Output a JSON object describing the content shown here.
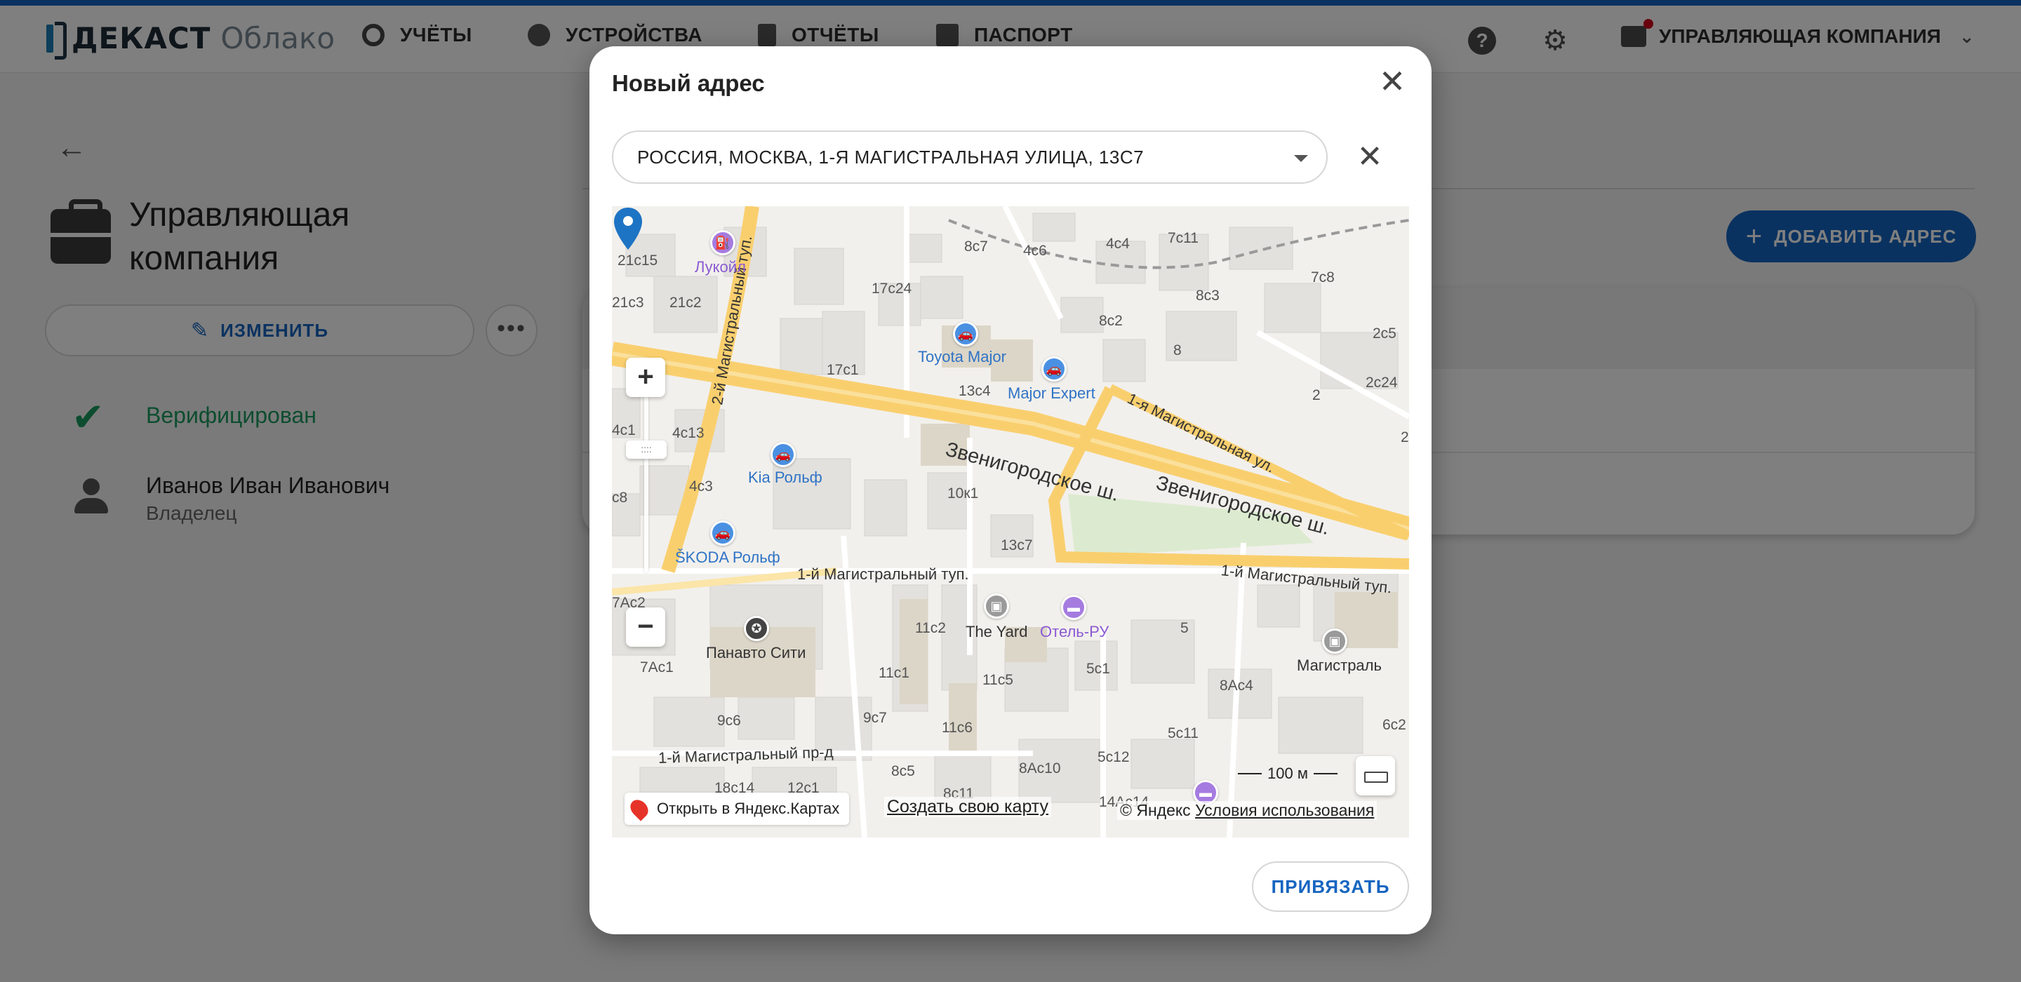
{
  "app": {
    "logo_text": "ДЕКАСТ",
    "logo_sub": "Облако"
  },
  "nav": {
    "items": [
      {
        "label": "УЧЁТЫ",
        "icon": "meter-icon"
      },
      {
        "label": "УСТРОЙСТВА",
        "icon": "device-icon"
      },
      {
        "label": "ОТЧЁТЫ",
        "icon": "report-icon"
      },
      {
        "label": "ПАСПОРТ",
        "icon": "passport-icon"
      }
    ],
    "help_icon": "?",
    "company_menu_label": "УПРАВЛЯЮЩАЯ КОМПАНИЯ"
  },
  "company": {
    "title": "Управляющая компания",
    "edit_label": "ИЗМЕНИТЬ",
    "more_label": "•••",
    "status": "Верифицирован",
    "owner_name": "Иванов Иван Иванович",
    "owner_role": "Владелец",
    "add_address_label": "ДОБАВИТЬ АДРЕС"
  },
  "dialog": {
    "title": "Новый адрес",
    "address_value": "РОССИЯ, МОСКВА, 1-Я МАГИСТРАЛЬНАЯ УЛИЦА, 13С7",
    "bind_label": "ПРИВЯЗАТЬ"
  },
  "map": {
    "open_in_yandex": "Открыть в Яндекс.Картах",
    "create_map": "Создать свою карту",
    "copyright": "© Яндекс",
    "terms": "Условия использования",
    "scale": "100 м",
    "streets": {
      "zvenigorodskoe_1": "Звенигородское ш.",
      "zvenigorodskoe_2": "Звенигородское ш.",
      "magistralny_tup_2": "2-й Магистральный туп.",
      "magistralnaya_ul_1": "1-я Магистральная ул.",
      "magistralny_tup_1_left": "1-й Магистральный туп.",
      "magistralny_tup_1_right": "1-й Магистральный туп.",
      "magistralny_pr": "1-й Магистральный пр-д"
    },
    "pois": {
      "lukoil": "Лукойл",
      "toyota": "Toyota Major",
      "major_expert": "Major Expert",
      "kia": "Kia Рольф",
      "skoda": "ŠKODA Рольф",
      "yard": "The Yard",
      "hotel": "Отель-РУ",
      "panavto": "Панавто Сити",
      "magistral": "Магистраль"
    },
    "building_numbers": {
      "b1": "21с15",
      "b2": "21с3",
      "b3": "21с2",
      "b4": "8с7",
      "b5": "4с6",
      "b6": "4с4",
      "b7": "7с11",
      "b8": "17с24",
      "b9": "7с8",
      "b10": "8с3",
      "b11": "8с2",
      "b12": "2с5",
      "b13": "8",
      "b14": "17с1",
      "b15": "13с4",
      "b16": "2с24",
      "b17": "2",
      "b18": "4с1",
      "b19": "4с13",
      "b20": "4с3",
      "b21": "с8",
      "b22": "10к1",
      "b23": "13с7",
      "b24": "11с2",
      "b25": "5",
      "b26": "7Ас1",
      "b27": "11с1",
      "b28": "8Ас4",
      "b29": "5с1",
      "b30": "11с5",
      "b31": "9с6",
      "b32": "9с7",
      "b33": "11с6",
      "b34": "6с2",
      "b35": "5с11",
      "b36": "8с5",
      "b37": "8Ас10",
      "b38": "5с12",
      "b39": "8с11",
      "b40": "14Ас14",
      "b41": "18с14",
      "b42": "12с1",
      "b43": "7Ас2",
      "b44": "2"
    }
  }
}
